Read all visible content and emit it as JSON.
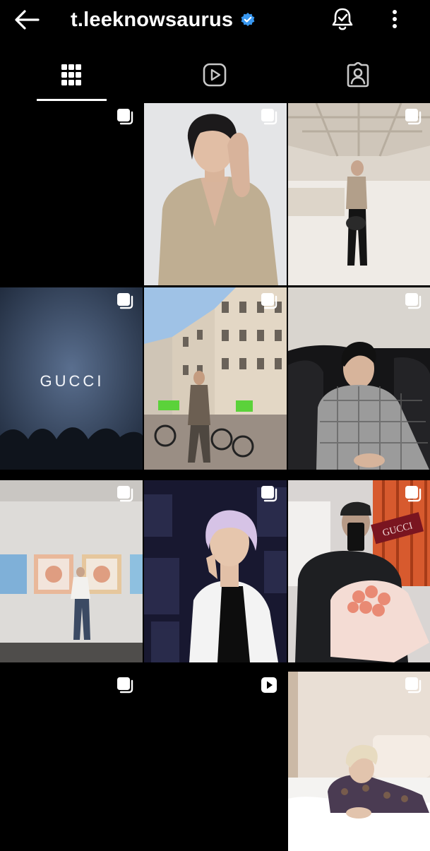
{
  "header": {
    "username": "t.leeknowsaurus",
    "verified_color": "#3897f0",
    "icons": [
      "back-arrow-icon",
      "verified-badge-icon",
      "notification-bell-icon",
      "more-vertical-icon"
    ]
  },
  "tabs": [
    {
      "name": "posts",
      "icon": "grid-icon",
      "selected": true
    },
    {
      "name": "reels",
      "icon": "reels-play-icon",
      "selected": false
    },
    {
      "name": "tagged",
      "icon": "tagged-person-icon",
      "selected": false
    }
  ],
  "posts": [
    {
      "badge": "carousel-icon",
      "text": ""
    },
    {
      "badge": "carousel-icon",
      "text": ""
    },
    {
      "badge": "carousel-icon",
      "text": ""
    },
    {
      "badge": "carousel-icon",
      "text": "GUCCI"
    },
    {
      "badge": "carousel-icon",
      "text": ""
    },
    {
      "badge": "carousel-icon",
      "text": ""
    },
    {
      "badge": "carousel-icon",
      "text": ""
    },
    {
      "badge": "carousel-icon",
      "text": ""
    },
    {
      "badge": "carousel-icon",
      "text": "GUCCI"
    },
    {
      "badge": "carousel-icon",
      "text": ""
    },
    {
      "badge": "reel-icon",
      "text": ""
    },
    {
      "badge": "carousel-icon",
      "text": ""
    }
  ]
}
